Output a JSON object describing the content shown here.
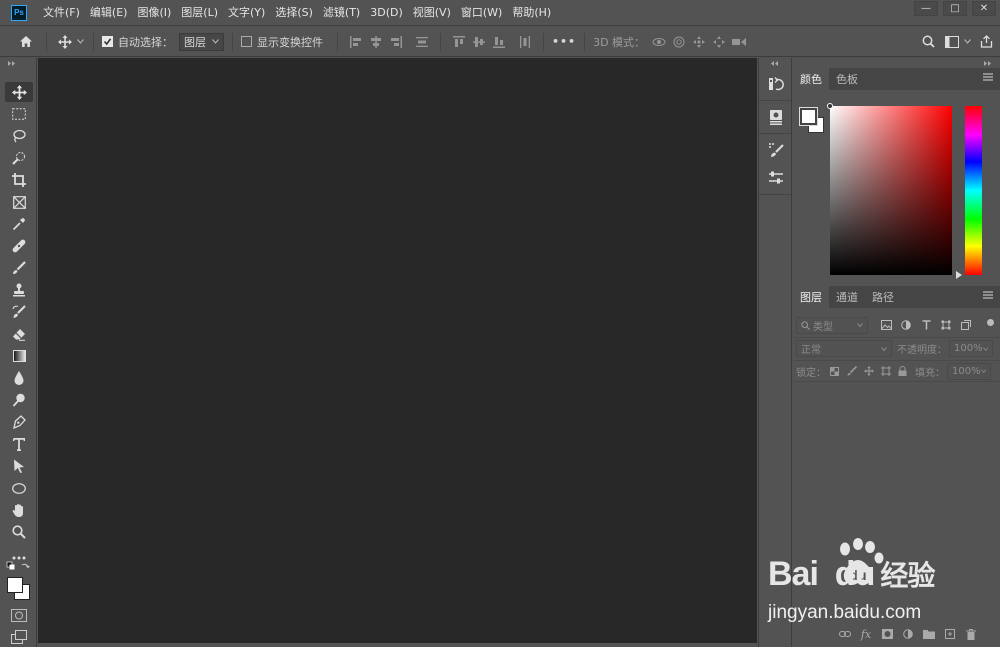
{
  "app": {
    "logo_text": "Ps"
  },
  "menu": [
    "文件(F)",
    "编辑(E)",
    "图像(I)",
    "图层(L)",
    "文字(Y)",
    "选择(S)",
    "滤镜(T)",
    "3D(D)",
    "视图(V)",
    "窗口(W)",
    "帮助(H)"
  ],
  "window_controls": {
    "minimize": "—",
    "maximize": "□",
    "close": "✕"
  },
  "options_bar": {
    "auto_select_label": "自动选择：",
    "auto_select_checked": true,
    "target_value": "图层",
    "show_transform_label": "显示变换控件",
    "show_transform_checked": false,
    "more_label": "•••",
    "mode_3d_label": "3D 模式："
  },
  "colors": {
    "accent": "#31a8ff",
    "canvas": "#282828",
    "ui": "#535353"
  },
  "color_panel": {
    "tabs": [
      "颜色",
      "色板"
    ],
    "active_tab": 0
  },
  "layers_panel": {
    "tabs": [
      "图层",
      "通道",
      "路径"
    ],
    "active_tab": 0,
    "filter_placeholder": "类型",
    "blend_mode": "正常",
    "opacity_label": "不透明度：",
    "opacity_value": "100%",
    "lock_label": "锁定：",
    "fill_label": "填充：",
    "fill_value": "100%"
  },
  "watermark": {
    "logo_text": "Bai  du",
    "brand_cn": "经验",
    "url": "jingyan.baidu.com"
  }
}
